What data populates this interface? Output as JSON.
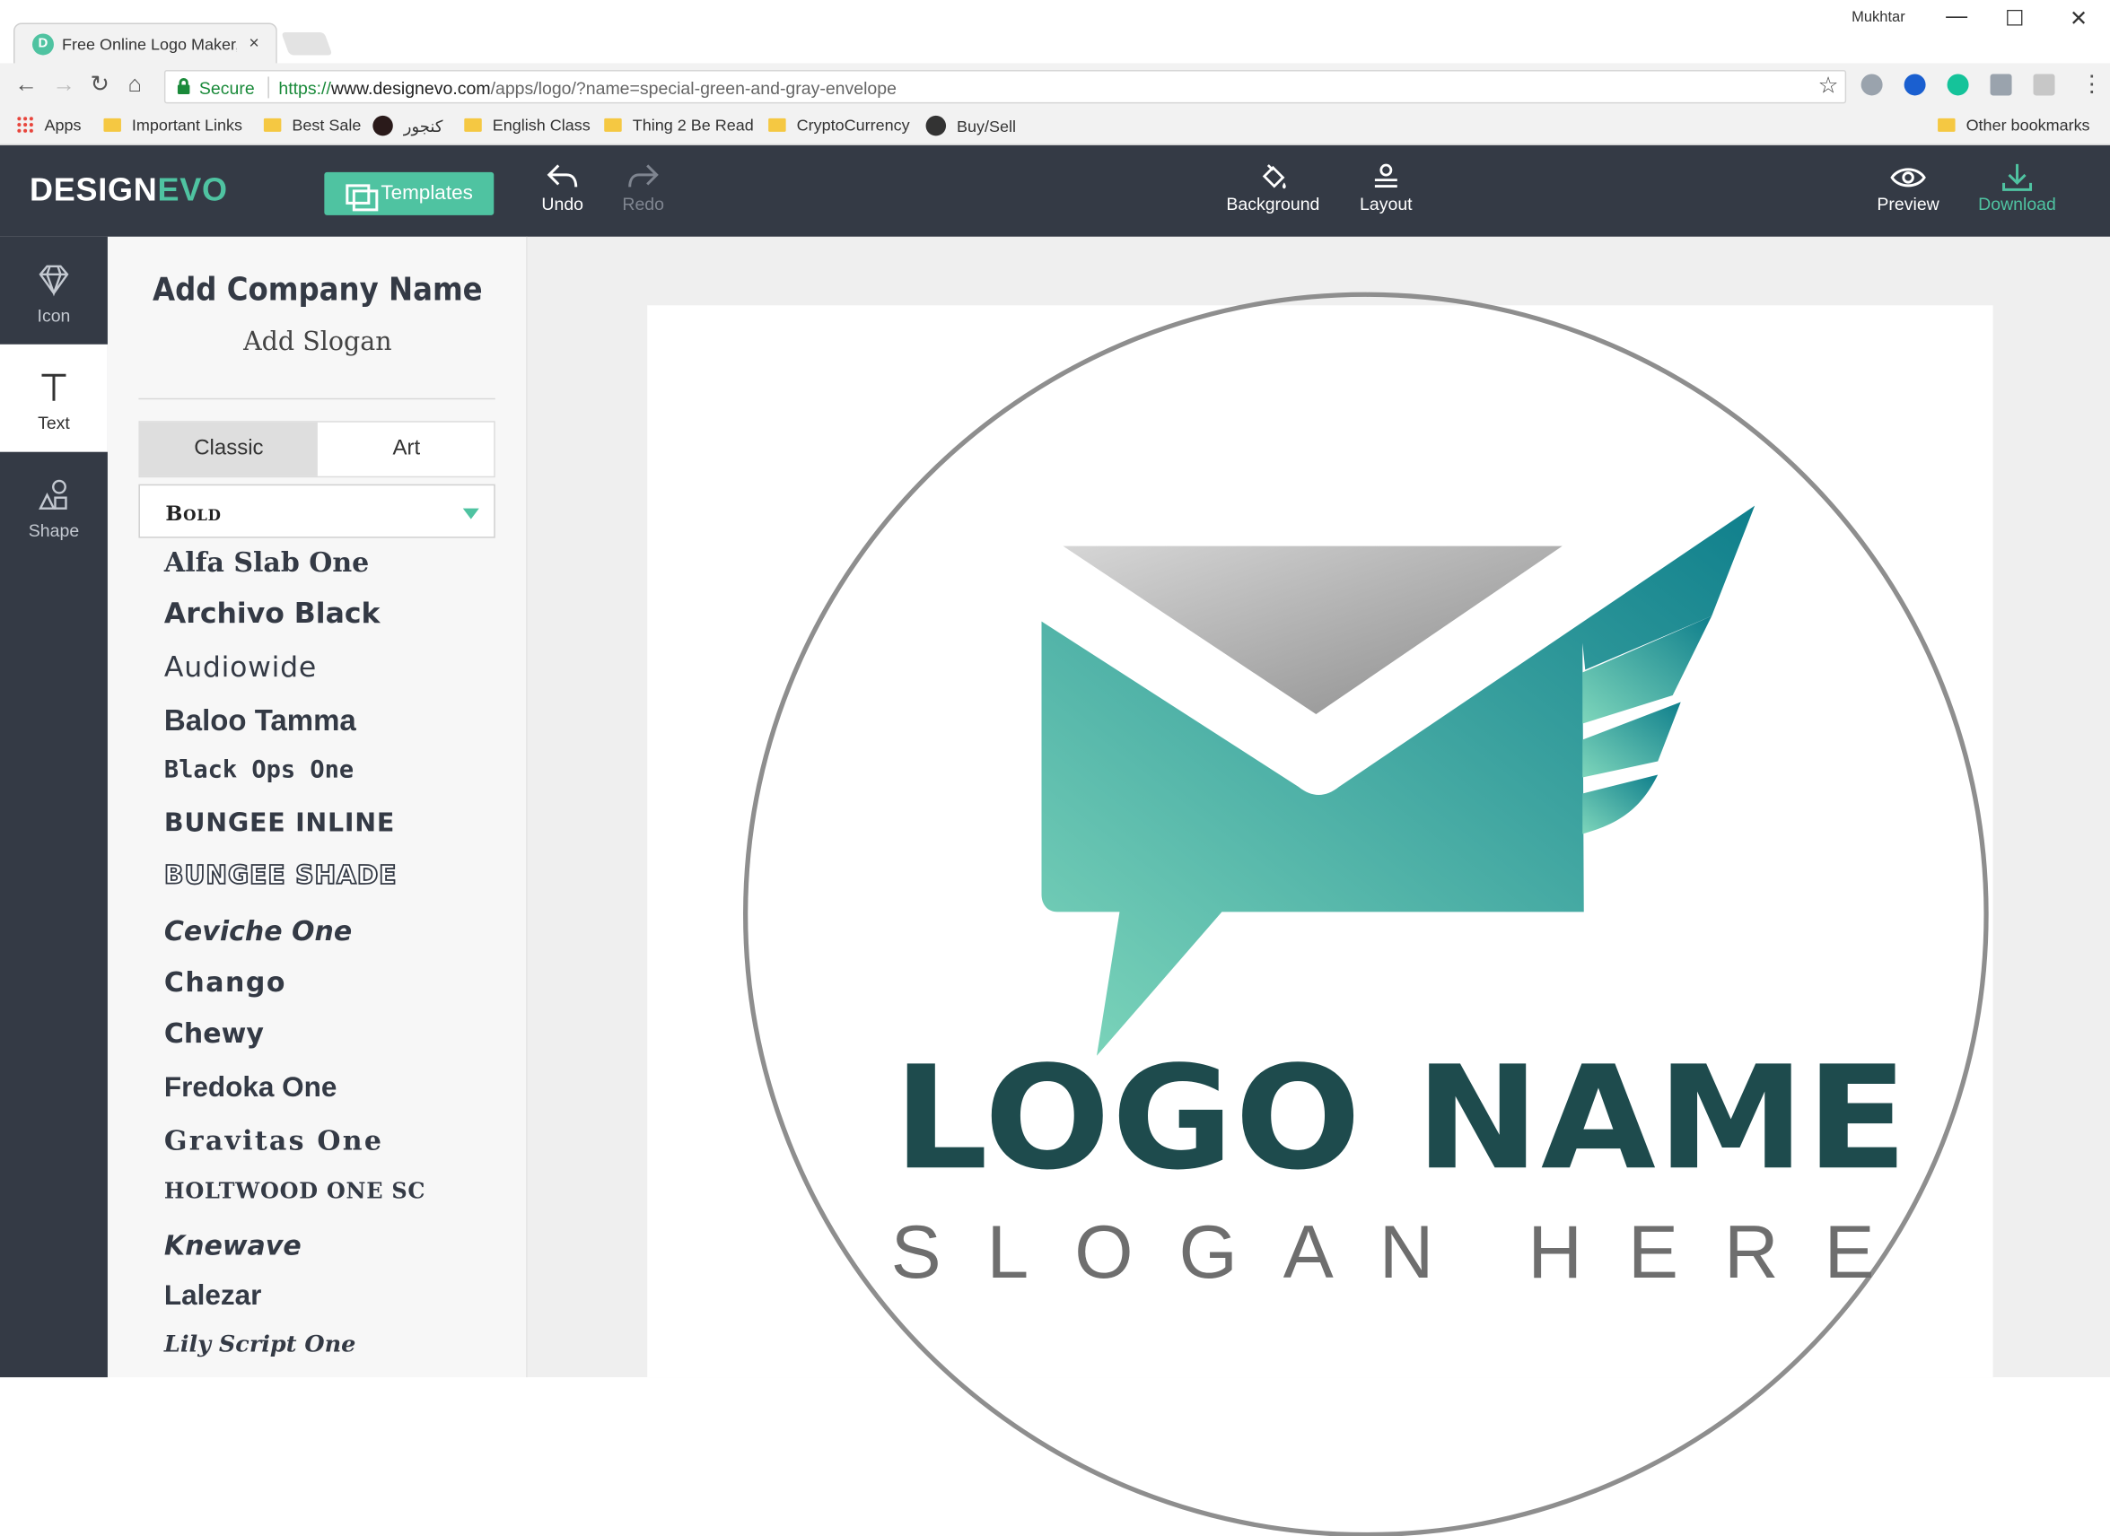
{
  "browser": {
    "tab_title": "Free Online Logo Maker,",
    "tab_close": "×",
    "user": "Mukhtar",
    "window_controls": [
      "—",
      "☐",
      "✕"
    ],
    "secure_label": "Secure",
    "url_scheme": "https://",
    "url_host": "www.designevo.com",
    "url_path": "/apps/logo/?name=special-green-and-gray-envelope",
    "star": "☆",
    "bookmarks": [
      "Apps",
      "Important Links",
      "Best Sale",
      "کنجور",
      "English Class",
      "Thing 2 Be Read",
      "CryptoCurrency",
      "Buy/Sell"
    ],
    "other_bookmarks": "Other bookmarks",
    "extension_icons": [
      "ext-bird-icon",
      "ext-a-icon",
      "ext-grammarly-icon",
      "ext-puzzle-icon",
      "ext-r-icon",
      "menu-dots-icon"
    ]
  },
  "app": {
    "logo_part1": "DESIGN",
    "logo_part2": "EVO",
    "templates_label": "Templates",
    "undo_label": "Undo",
    "redo_label": "Redo",
    "background_label": "Background",
    "layout_label": "Layout",
    "preview_label": "Preview",
    "download_label": "Download",
    "accent_color": "#4fc3a1",
    "header_color": "#343a45"
  },
  "rail": {
    "items": [
      {
        "label": "Icon",
        "icon": "diamond-icon",
        "active": false
      },
      {
        "label": "Text",
        "icon": "text-icon",
        "active": true
      },
      {
        "label": "Shape",
        "icon": "shapes-icon",
        "active": false
      }
    ]
  },
  "panel": {
    "add_company": "Add Company Name",
    "add_slogan": "Add Slogan",
    "tabs": [
      "Classic",
      "Art"
    ],
    "active_tab": "Classic",
    "font_category": "Bold",
    "fonts": [
      "Alfa Slab One",
      "Archivo Black",
      "Audiowide",
      "Baloo Tamma",
      "Black Ops One",
      "BUNGEE INLINE",
      "BUNGEE SHADE",
      "Ceviche One",
      "Chango",
      "Chewy",
      "Fredoka One",
      "Gravitas One",
      "HOLTWOOD ONE SC",
      "Knewave",
      "Lalezar",
      "Lily Script One"
    ]
  },
  "canvas": {
    "logo_name": "LOGO NAME",
    "slogan_word1": "SLOGAN",
    "slogan_word2": "HERE",
    "name_color": "#1e4b4d",
    "slogan_color": "#6e6e6e",
    "envelope_gradient": [
      "#7ed6bb",
      "#0f7f8c"
    ],
    "flap_gradient": [
      "#d0d0d0",
      "#8f8f8f"
    ]
  }
}
